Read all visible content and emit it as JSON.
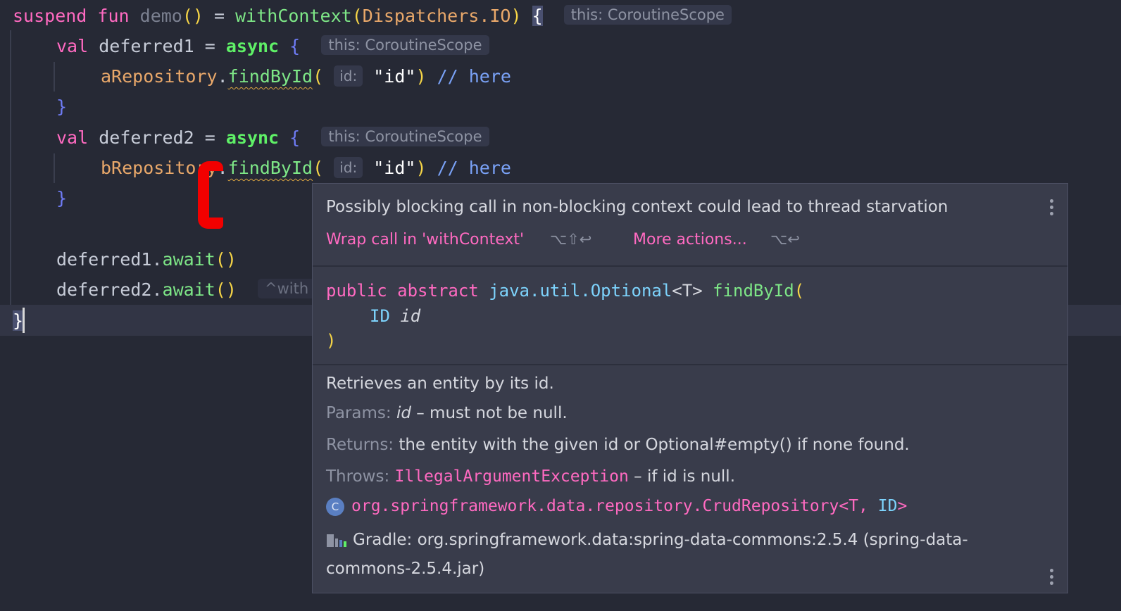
{
  "editor": {
    "line1": {
      "suspend": "suspend",
      "fun": "fun",
      "name": "demo",
      "parens": "()",
      "eq": " = ",
      "call": "withContext",
      "open": "(",
      "arg": "Dispatchers.IO",
      "close": ")",
      "brace": "{",
      "hint": "this: CoroutineScope"
    },
    "line2": {
      "val": "val",
      "name": "deferred1",
      "eq": " = ",
      "fn": "async",
      "brace": "{",
      "hint": "this: CoroutineScope"
    },
    "line3": {
      "obj": "aRepository",
      "dot": ".",
      "call": "findById",
      "open": "(",
      "phint": "id:",
      "str": "\"id\"",
      "close": ")",
      "comment": "// here"
    },
    "line4": {
      "brace": "}"
    },
    "line5": {
      "val": "val",
      "name": "deferred2",
      "eq": " = ",
      "fn": "async",
      "brace": "{",
      "hint": "this: CoroutineScope"
    },
    "line6": {
      "obj": "bRepository",
      "dot": ".",
      "call": "findById",
      "open": "(",
      "phint": "id:",
      "str": "\"id\"",
      "close": ")",
      "comment": "// here"
    },
    "line7": {
      "brace": "}"
    },
    "line8": {
      "obj": "deferred1",
      "dot": ".",
      "call": "await",
      "parens": "()"
    },
    "line9": {
      "obj": "deferred2",
      "dot": ".",
      "call": "await",
      "parens": "()",
      "hint": "^with"
    },
    "line10": {
      "brace": "}"
    }
  },
  "popup": {
    "warning": "Possibly blocking call in non-blocking context could lead to thread starvation",
    "action1": "Wrap call in 'withContext'",
    "action1_shortcut": "⌥⇧↩",
    "action2": "More actions...",
    "action2_shortcut": "⌥↩",
    "signature": {
      "modifiers": "public abstract",
      "type": "java.util.Optional",
      "generic": "<T>",
      "name": "findById",
      "open": "(",
      "param_type": "ID",
      "param_name": "id",
      "close": ")"
    },
    "doc": {
      "summary": "Retrieves an entity by its id.",
      "params_label": "Params:",
      "param_name": "id",
      "param_desc": "– must not be null.",
      "returns_label": "Returns:",
      "returns_desc": "the entity with the given id or Optional#empty() if none found.",
      "throws_label": "Throws:",
      "throws_type": "IllegalArgumentException",
      "throws_desc": "– if id is null.",
      "class_icon_letter": "C",
      "class_name": "org.springframework.data.repository.CrudRepository",
      "class_generic_open": "<T, ",
      "class_generic_id": "ID",
      "class_generic_close": ">",
      "library_line1": "Gradle: org.springframework.data:spring-data-commons:2.5.4 (spring-data-",
      "library_line2": "commons-2.5.4.jar)"
    }
  },
  "colors": {
    "background": "#262935",
    "keyword": "#ff6ac1",
    "string": "#ffffff",
    "comment": "#7aa2f7",
    "annotation_mark": "#f20000"
  }
}
